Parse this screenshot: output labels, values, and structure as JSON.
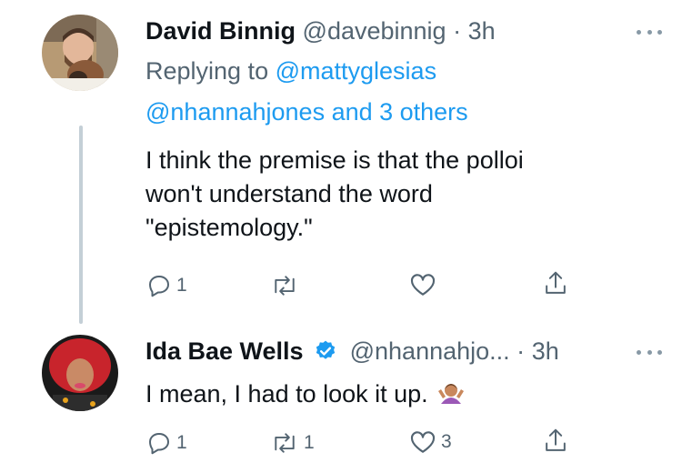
{
  "tweets": [
    {
      "author_name": "David Binnig",
      "handle": "@davebinnig",
      "separator": "·",
      "time": "3h",
      "replying_prefix": "Replying to",
      "replying_user": "@mattyglesias",
      "replying_extra": "@nhannahjones and 3 others",
      "text_lines": [
        "I think the premise is that the polloi",
        "won't understand the word",
        "\"epistemology.\""
      ],
      "reply_count": "1",
      "retweet_count": "",
      "like_count": ""
    },
    {
      "author_name": "Ida Bae Wells",
      "verified": true,
      "handle": "@nhannahjo...",
      "separator": "·",
      "time": "3h",
      "text": "I mean, I had to look it up.",
      "emoji": "person-shrugging-icon",
      "reply_count": "1",
      "retweet_count": "1",
      "like_count": "3"
    }
  ],
  "colors": {
    "link": "#1d9bf0",
    "muted": "#536471",
    "thread_line": "#c4cfd6",
    "icon": "#536471"
  }
}
